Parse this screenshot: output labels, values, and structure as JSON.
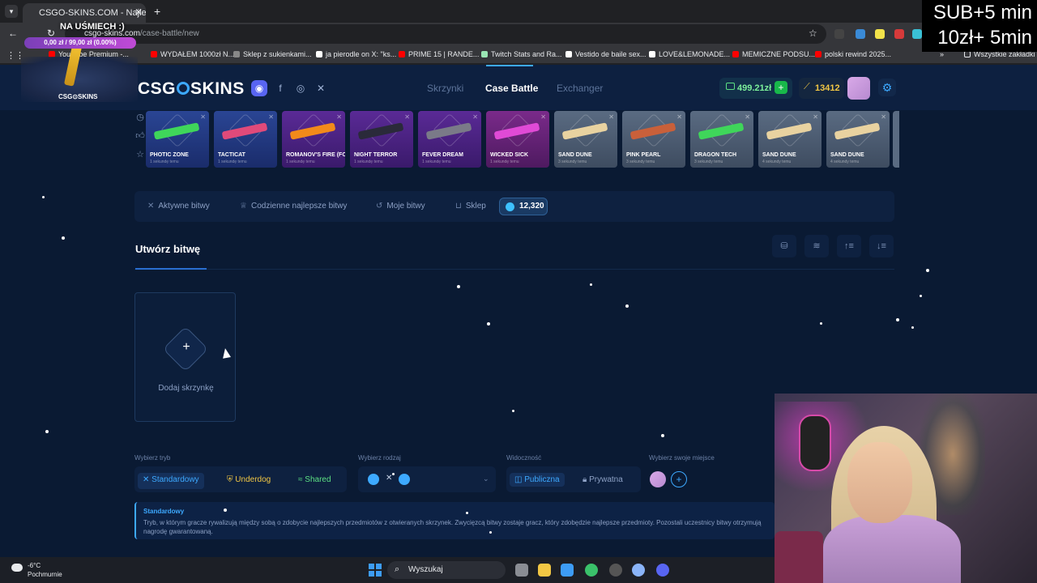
{
  "browser": {
    "tab_title": "CSGO-SKINS.COM - Najlepsze",
    "tab_close": "✕",
    "new_tab": "+",
    "url_domain": "csgo-skins.com",
    "url_path": "/case-battle/new",
    "bookmarks": [
      "YouTube Premium -...",
      "WYDAŁEM 1000zł N...",
      "Sklep z sukienkami...",
      "ja pierodle on X: \"ks...",
      "PRIME 15 | RANDE...",
      "Twitch Stats and Ra...",
      "Vestido de baile sex...",
      "LOVE&LEMONADE...",
      "MEMICZNE PODSU...",
      "polski rewind 2025...",
      "Wszystkie zakładki"
    ]
  },
  "stream_overlay": {
    "title": "NA UŚMIECH :)",
    "progress": "0,00 zł / 99,00 zł (0.00%)",
    "progress_percent": 0,
    "logo": "CSG⊙SKINS",
    "sub_line1": "SUB+5 min",
    "sub_line2": "10zł+ 5min"
  },
  "site": {
    "logo_part1": "CSG",
    "logo_part2": "SKINS",
    "nav": [
      "Skrzynki",
      "Case Battle",
      "Exchanger"
    ],
    "balance": "499.21zł",
    "gems": "13412",
    "drops": [
      {
        "name": "PHOTIC ZONE",
        "time": "1 sekundę temu",
        "color": "blue",
        "gun": "#3fd65a"
      },
      {
        "name": "TACTICAT",
        "time": "1 sekundę temu",
        "color": "blue",
        "gun": "#e04a7a"
      },
      {
        "name": "ROMANOV'S FIRE (FOIL)",
        "time": "1 sekundę temu",
        "color": "purple",
        "gun": "#f28a1a"
      },
      {
        "name": "NIGHT TERROR",
        "time": "1 sekundę temu",
        "color": "purple",
        "gun": "#2a2a3a"
      },
      {
        "name": "FEVER DREAM",
        "time": "1 sekundę temu",
        "color": "purple",
        "gun": "#7a7a88"
      },
      {
        "name": "WICKED SICK",
        "time": "1 sekundę temu",
        "color": "pink",
        "gun": "#e04ad6"
      },
      {
        "name": "SAND DUNE",
        "time": "3 sekundy temu",
        "color": "gray",
        "gun": "#e8d2a0"
      },
      {
        "name": "PINK PEARL",
        "time": "3 sekundy temu",
        "color": "gray",
        "gun": "#c9603a"
      },
      {
        "name": "DRAGON TECH",
        "time": "3 sekundy temu",
        "color": "gray",
        "gun": "#3fd65a"
      },
      {
        "name": "SAND DUNE",
        "time": "4 sekundy temu",
        "color": "gray",
        "gun": "#e8d2a0"
      },
      {
        "name": "SAND DUNE",
        "time": "4 sekundy temu",
        "color": "gray",
        "gun": "#e8d2a0"
      }
    ],
    "battle_nav": [
      "Aktywne bitwy",
      "Codzienne najlepsze bitwy",
      "Moje bitwy",
      "Sklep"
    ],
    "coins": "12,320",
    "create_title": "Utwórz bitwę",
    "add_case_label": "Dodaj skrzynkę",
    "mode_label": "Wybierz tryb",
    "modes": [
      "Standardowy",
      "Underdog",
      "Shared"
    ],
    "type_label": "Wybierz rodzaj",
    "visibility_label": "Widoczność",
    "visibility": [
      "Publiczna",
      "Prywatna"
    ],
    "seat_label": "Wybierz swoje miejsce",
    "info_title": "Standardowy",
    "info_text": "Tryb, w którym gracze rywalizują między sobą o zdobycie najlepszych przedmiotów z otwieranych skrzynek. Zwycięzcą bitwy zostaje gracz, który zdobędzie najlepsze przedmioty. Pozostali uczestnicy bitwy otrzymują nagrodę gwarantowaną."
  },
  "taskbar": {
    "temperature": "-6°C",
    "weather": "Pochmurnie",
    "search": "Wyszukaj"
  },
  "colors": {
    "accent": "#3da9ff",
    "background": "#0a1a33",
    "balance_green": "#7cf09a",
    "gems_gold": "#f2c744"
  }
}
